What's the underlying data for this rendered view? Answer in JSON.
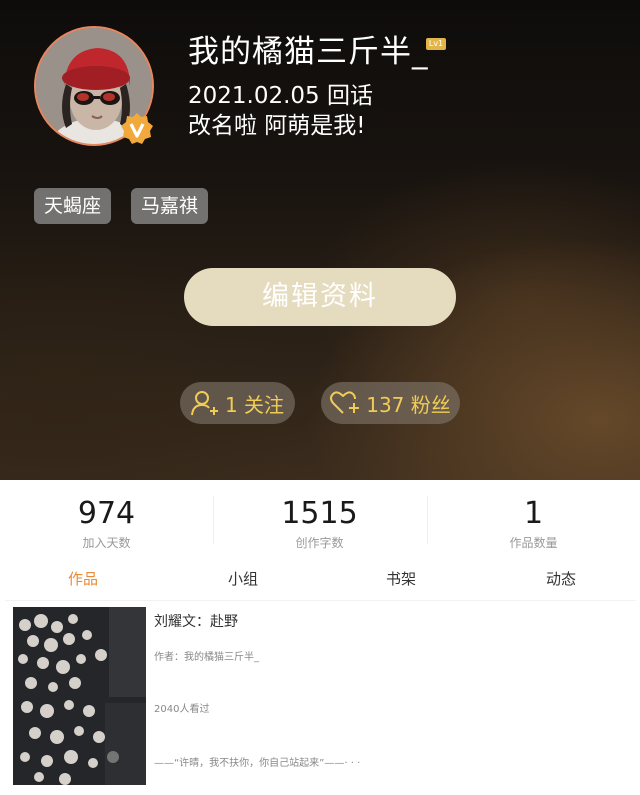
{
  "profile": {
    "nickname": "我的橘猫三斤半_",
    "level_badge": "Lv1",
    "bio_line1": "2021.02.05 回话",
    "bio_line2": "改名啦 阿萌是我!",
    "avatar_border_color": "#e8865f",
    "verified_color": "#f2a93b"
  },
  "tags": [
    "天蝎座",
    "马嘉祺"
  ],
  "edit_button": {
    "label": "编辑资料"
  },
  "social": {
    "follow_label": "1 关注",
    "fans_label": "137 粉丝",
    "follow_icon": "add-user-icon",
    "fans_icon": "heart-plus-icon",
    "accent": "#f0cc57"
  },
  "stats": [
    {
      "value": "974",
      "label": "加入天数"
    },
    {
      "value": "1515",
      "label": "创作字数"
    },
    {
      "value": "1",
      "label": "作品数量"
    }
  ],
  "tabs": [
    {
      "label": "作品",
      "active": true
    },
    {
      "label": "小组",
      "active": false
    },
    {
      "label": "书架",
      "active": false
    },
    {
      "label": "动态",
      "active": false
    }
  ],
  "active_tab_color": "#e98b34",
  "work": {
    "title": "刘耀文：赴野",
    "author": "作者：我的橘猫三斤半_",
    "views": "2040人看过",
    "excerpt": "——“许晴，我不扶你，你自己站起来”——· · ·"
  }
}
